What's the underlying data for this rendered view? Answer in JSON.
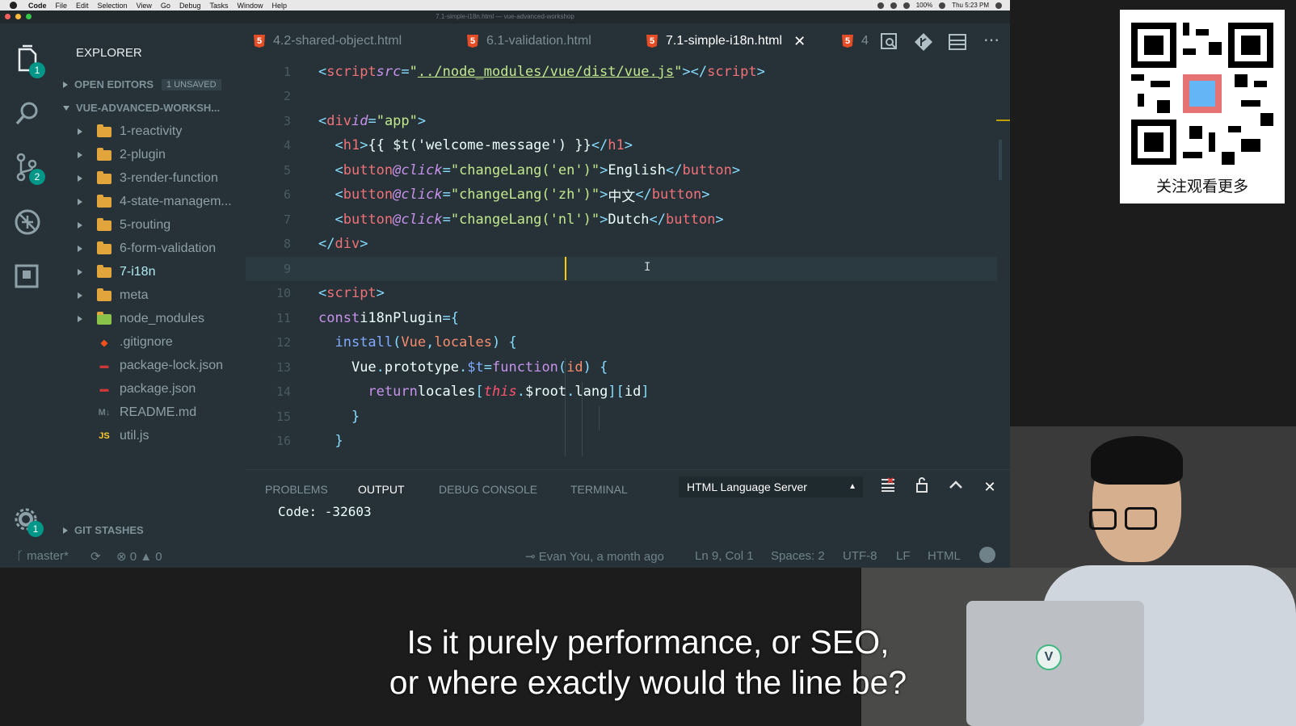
{
  "menubar": {
    "app": "Code",
    "items": [
      "File",
      "Edit",
      "Selection",
      "View",
      "Go",
      "Debug",
      "Tasks",
      "Window",
      "Help"
    ],
    "battery": "100%",
    "clock": "Thu 5:23 PM"
  },
  "window": {
    "title": "7.1-simple-i18n.html — vue-advanced-workshop"
  },
  "activity": {
    "explorer_badge": "1",
    "scm_badge": "2",
    "settings_badge": "1"
  },
  "sidebar": {
    "title": "EXPLORER",
    "open_editors": "OPEN EDITORS",
    "unsaved": "1 UNSAVED",
    "project": "VUE-ADVANCED-WORKSH...",
    "items": [
      {
        "label": "1-reactivity",
        "type": "folder"
      },
      {
        "label": "2-plugin",
        "type": "folder"
      },
      {
        "label": "3-render-function",
        "type": "folder"
      },
      {
        "label": "4-state-managem...",
        "type": "folder"
      },
      {
        "label": "5-routing",
        "type": "folder"
      },
      {
        "label": "6-form-validation",
        "type": "folder"
      },
      {
        "label": "7-i18n",
        "type": "folder"
      },
      {
        "label": "meta",
        "type": "folder"
      },
      {
        "label": "node_modules",
        "type": "folder"
      },
      {
        "label": ".gitignore",
        "type": "git"
      },
      {
        "label": "package-lock.json",
        "type": "npm"
      },
      {
        "label": "package.json",
        "type": "npm"
      },
      {
        "label": "README.md",
        "type": "md"
      },
      {
        "label": "util.js",
        "type": "js"
      }
    ],
    "git_stashes": "GIT STASHES"
  },
  "tabs": [
    {
      "label": "4.2-shared-object.html",
      "active": false
    },
    {
      "label": "6.1-validation.html",
      "active": false
    },
    {
      "label": "7.1-simple-i18n.html",
      "active": true
    },
    {
      "label": "4",
      "active": false
    }
  ],
  "editor": {
    "line_numbers": [
      "1",
      "2",
      "3",
      "4",
      "5",
      "6",
      "7",
      "8",
      "9",
      "10",
      "11",
      "12",
      "13",
      "14",
      "15",
      "16"
    ],
    "cursor_line": 9
  },
  "panel": {
    "tabs": [
      "PROBLEMS",
      "OUTPUT",
      "DEBUG CONSOLE",
      "TERMINAL"
    ],
    "active_tab": "OUTPUT",
    "channel": "HTML Language Server",
    "output": "Code: -32603"
  },
  "statusbar": {
    "branch": "master*",
    "errors": "0",
    "warnings": "0",
    "blame": "Evan You, a month ago",
    "position": "Ln 9, Col 1",
    "spaces": "Spaces: 2",
    "encoding": "UTF-8",
    "eol": "LF",
    "language": "HTML"
  },
  "qr": {
    "caption": "关注观看更多"
  },
  "video": {
    "sticker": "V",
    "subtitle_line1": "Is it purely performance, or SEO,",
    "subtitle_line2": "or where exactly would the line be?"
  },
  "colors": {
    "editor_bg": "#263238",
    "accent": "#009688",
    "cursor": "#ffcc00"
  }
}
